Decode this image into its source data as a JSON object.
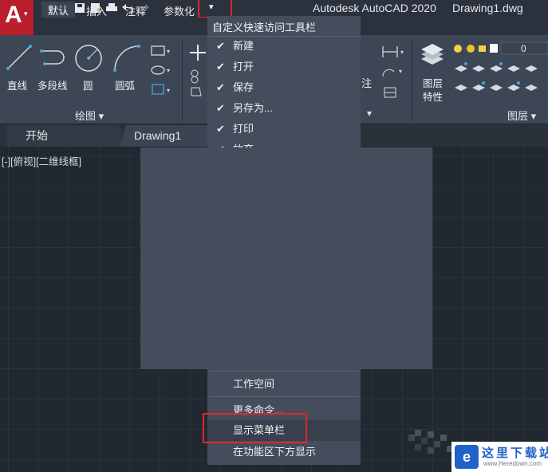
{
  "titlebar": {
    "logo_letter": "A",
    "app_title": "Autodesk AutoCAD 2020",
    "doc_title": "Drawing1.dwg"
  },
  "ribbon_tabs": [
    "默认",
    "插入",
    "注释",
    "参数化"
  ],
  "ribbon": {
    "draw_tools": [
      "直线",
      "多段线",
      "圆",
      "圆弧"
    ],
    "draw_panel_title": "绘图 ▾",
    "layer_tool_label_line1": "图层",
    "layer_tool_label_line2": "特性",
    "layer_panel_title": "图层 ▾",
    "layer_value": "0",
    "annotation_fragment": "注"
  },
  "doc_tabs": [
    "开始",
    "Drawing1"
  ],
  "viewport_label": "[-][俯视][二维线框]",
  "quick_access_menu": {
    "header": "自定义快速访问工具栏",
    "checked_items": [
      "新建",
      "打开",
      "保存",
      "另存为...",
      "打印",
      "放弃"
    ],
    "bottom_items": [
      "工作空间",
      "更多命令...",
      "显示菜单栏",
      "在功能区下方显示"
    ],
    "highlighted_item": "显示菜单栏"
  },
  "watermark": {
    "logo_char": "e",
    "name": "这里下载站",
    "url": "www.Heredown.com"
  },
  "colors": {
    "accent_red": "#e0262e",
    "autocad_red": "#b81e2c",
    "menu_bg": "#454d5c",
    "ribbon_bg": "#3d4654",
    "canvas_bg": "#212830"
  }
}
